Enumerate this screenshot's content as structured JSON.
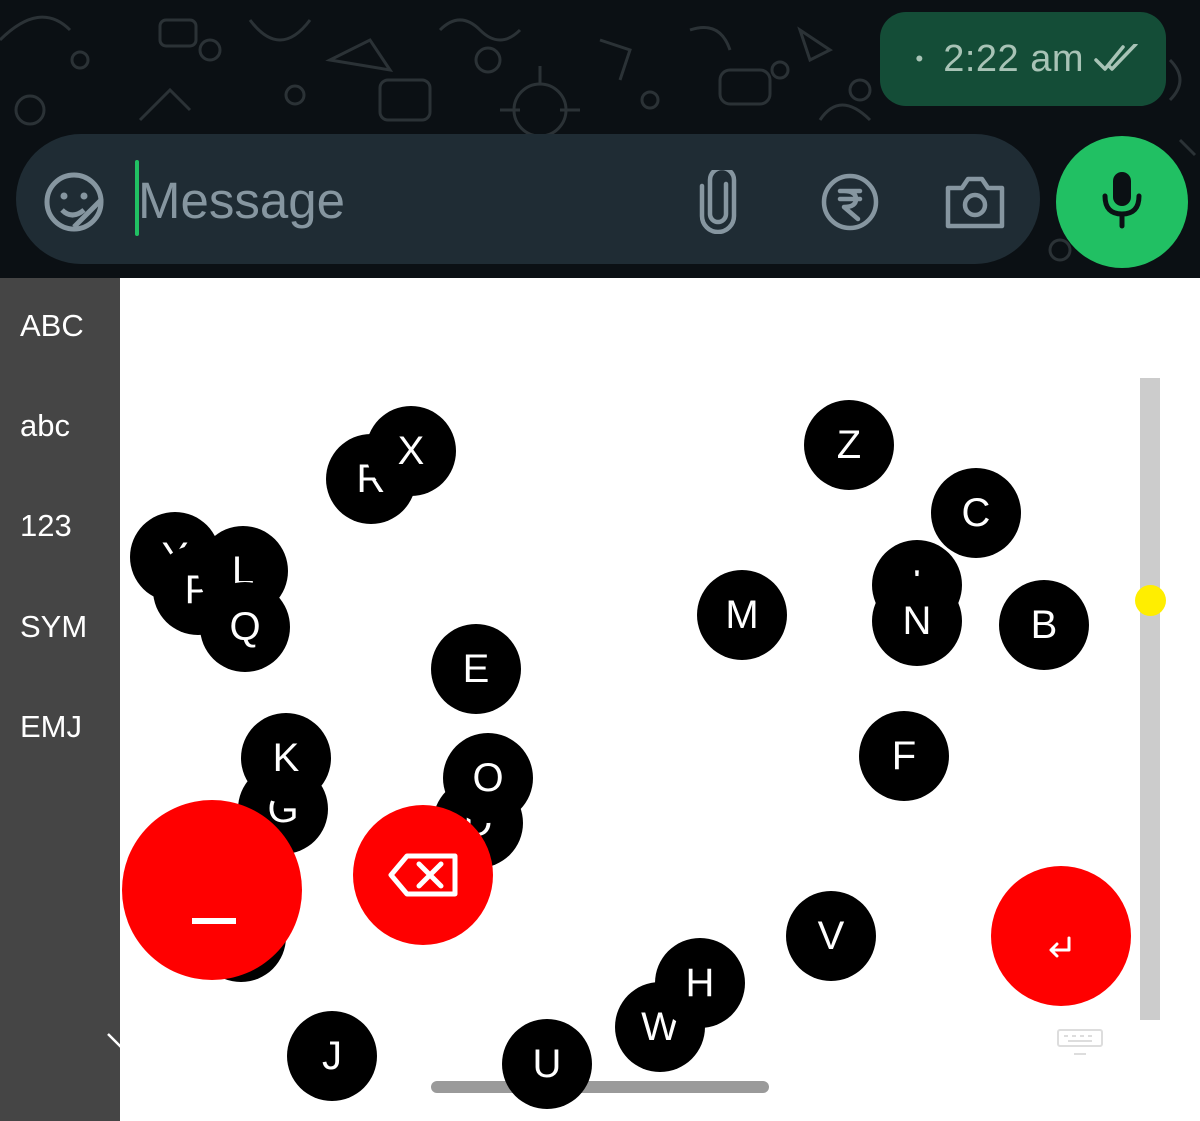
{
  "chat": {
    "last_message_time": "2:22 am",
    "status_dot": "•",
    "input_placeholder": "Message",
    "icons": [
      "sticker-emoji-icon",
      "attach-paperclip-icon",
      "rupee-payment-icon",
      "camera-icon",
      "microphone-icon",
      "double-check-icon"
    ]
  },
  "keyboard": {
    "modes": [
      "ABC",
      "abc",
      "123",
      "SYM",
      "EMJ"
    ],
    "keys": [
      {
        "id": "r",
        "label": "R"
      },
      {
        "id": "x",
        "label": "X"
      },
      {
        "id": "z",
        "label": "Z"
      },
      {
        "id": "c",
        "label": "C"
      },
      {
        "id": "y",
        "label": "Y"
      },
      {
        "id": "p",
        "label": "P"
      },
      {
        "id": "l",
        "label": "L"
      },
      {
        "id": "q",
        "label": "Q"
      },
      {
        "id": "apostrophe",
        "label": "'"
      },
      {
        "id": "n",
        "label": "N"
      },
      {
        "id": "m",
        "label": "M"
      },
      {
        "id": "b",
        "label": "B"
      },
      {
        "id": "e",
        "label": "E"
      },
      {
        "id": "f",
        "label": "F"
      },
      {
        "id": "k",
        "label": "K"
      },
      {
        "id": "g",
        "label": "G"
      },
      {
        "id": "o",
        "label": "O"
      },
      {
        "id": "d",
        "label": "D"
      },
      {
        "id": "v",
        "label": "V"
      },
      {
        "id": "h",
        "label": "H"
      },
      {
        "id": "w",
        "label": "W"
      },
      {
        "id": "j",
        "label": "J"
      },
      {
        "id": "u",
        "label": "U"
      }
    ],
    "action_icons": [
      "space-underscore-icon",
      "backspace-icon",
      "enter-icon",
      "chevron-down-icon",
      "keyboard-icon"
    ],
    "colors": {
      "key": "#000000",
      "action": "#ff0000",
      "sidebar": "#454545",
      "slider_knob": "#ffee00",
      "mic": "#21c063",
      "bubble": "#144d37"
    }
  }
}
